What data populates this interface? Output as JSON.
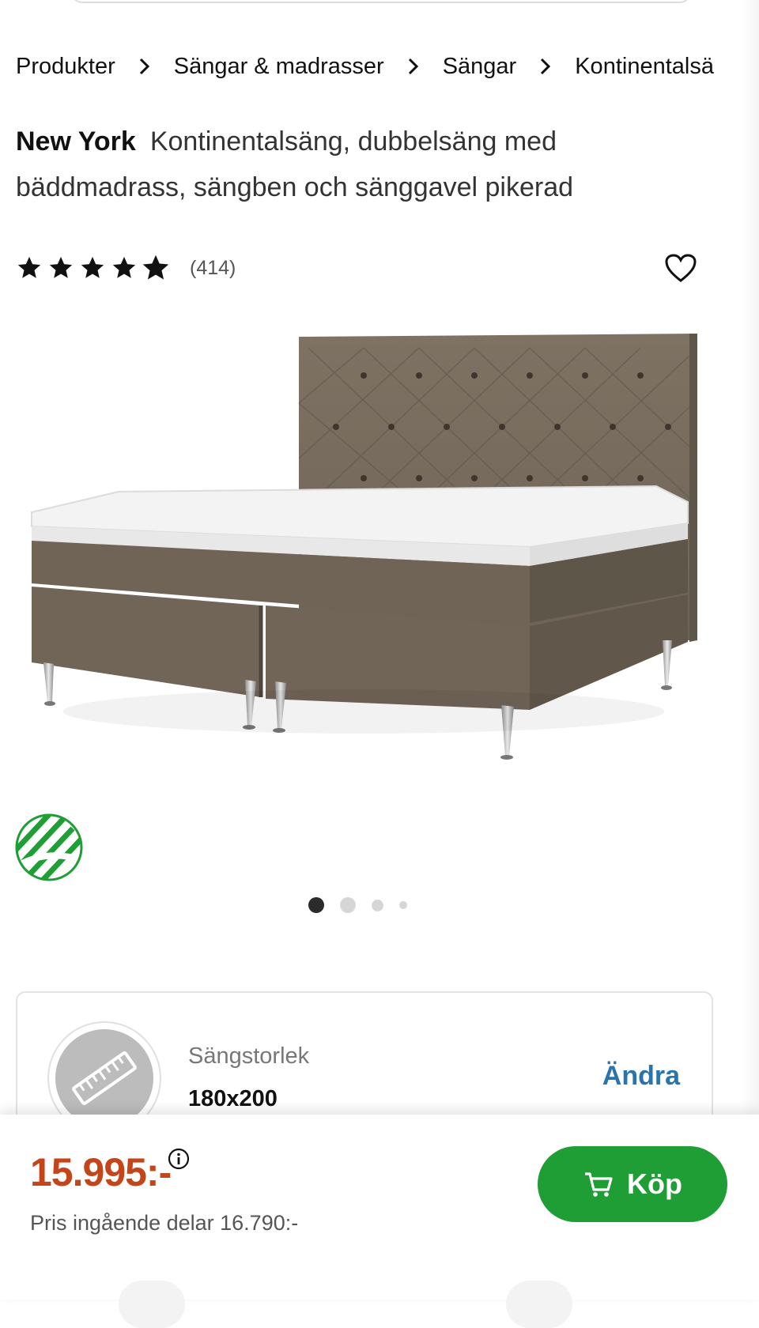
{
  "breadcrumb": {
    "items": [
      "Produkter",
      "Sängar & madrasser",
      "Sängar",
      "Kontinentalsä"
    ]
  },
  "product": {
    "name": "New York",
    "description": "Kontinentalsäng, dubbelsäng med bäddmadrass, sängben och sänggavel pikerad",
    "rating_value": 4.5,
    "review_count": "(414)"
  },
  "gallery": {
    "image_count": 4,
    "active_index": 0
  },
  "option": {
    "label": "Sängstorlek",
    "value": "180x200",
    "change_label": "Ändra"
  },
  "purchase": {
    "price": "15.995:-",
    "price_note": "Pris ingående delar 16.790:-",
    "buy_label": "Köp"
  },
  "colors": {
    "price": "#c4451a",
    "buy": "#1f9e36",
    "link": "#2a74ad",
    "eco": "#1f9e36"
  },
  "icons": {
    "separator": "chevron-right-icon",
    "wishlist": "heart-icon",
    "info": "info-icon",
    "cart": "cart-icon",
    "eco": "nordic-swan-ecolabel",
    "size": "ruler-icon"
  }
}
